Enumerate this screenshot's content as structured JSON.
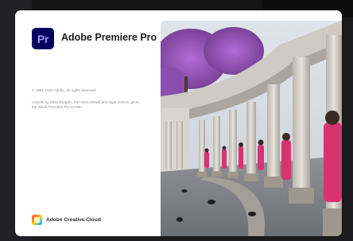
{
  "splash": {
    "logo_text": "Pr",
    "app_name": "Adobe Premiere Pro",
    "copyright": "© 1991-2022 Adobe. All rights reserved.",
    "artwork_credit": "Artwork by Elise Swopes. For more details and legal notices, go to the About Premiere Pro screen.",
    "footer_brand": "Adobe Creative Cloud"
  },
  "colors": {
    "premiere_badge": "#00005b",
    "premiere_letters": "#9999ff",
    "splash_background": "#ffffff"
  },
  "icons": [
    "premiere-pro-logo-icon",
    "creative-cloud-icon"
  ]
}
